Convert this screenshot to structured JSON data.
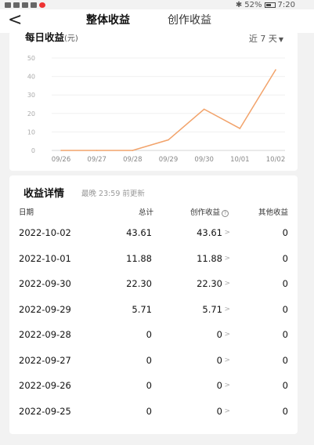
{
  "status_bar": {
    "battery": "52%",
    "time": "7:20"
  },
  "nav": {
    "back_icon": "chevron-left-icon",
    "tabs": [
      {
        "label": "整体收益",
        "active": true
      },
      {
        "label": "创作收益",
        "active": false
      }
    ],
    "accent": "#e8453c"
  },
  "chart_card": {
    "title": "每日收益",
    "unit": "(元)",
    "range_label": "近 7 天",
    "range_caret": "▼"
  },
  "chart_data": {
    "type": "line",
    "x": [
      "09/26",
      "09/27",
      "09/28",
      "09/29",
      "09/30",
      "10/01",
      "10/02"
    ],
    "series": [
      {
        "values": [
          0,
          0,
          0,
          5.71,
          22.3,
          11.88,
          43.61
        ],
        "color": "#f2a36b"
      }
    ],
    "yticks": [
      0,
      10,
      20,
      30,
      40,
      50
    ],
    "ylim": [
      0,
      50
    ]
  },
  "detail": {
    "title": "收益详情",
    "note": "最晚 23:59 前更新",
    "columns": {
      "date": "日期",
      "total": "总计",
      "create": "创作收益",
      "other": "其他收益"
    },
    "help_icon": "?",
    "arrow": ">",
    "rows": [
      {
        "date": "2022-10-02",
        "total": "43.61",
        "create": "43.61",
        "other": "0"
      },
      {
        "date": "2022-10-01",
        "total": "11.88",
        "create": "11.88",
        "other": "0"
      },
      {
        "date": "2022-09-30",
        "total": "22.30",
        "create": "22.30",
        "other": "0"
      },
      {
        "date": "2022-09-29",
        "total": "5.71",
        "create": "5.71",
        "other": "0"
      },
      {
        "date": "2022-09-28",
        "total": "0",
        "create": "0",
        "other": "0"
      },
      {
        "date": "2022-09-27",
        "total": "0",
        "create": "0",
        "other": "0"
      },
      {
        "date": "2022-09-26",
        "total": "0",
        "create": "0",
        "other": "0"
      },
      {
        "date": "2022-09-25",
        "total": "0",
        "create": "0",
        "other": "0"
      }
    ]
  }
}
